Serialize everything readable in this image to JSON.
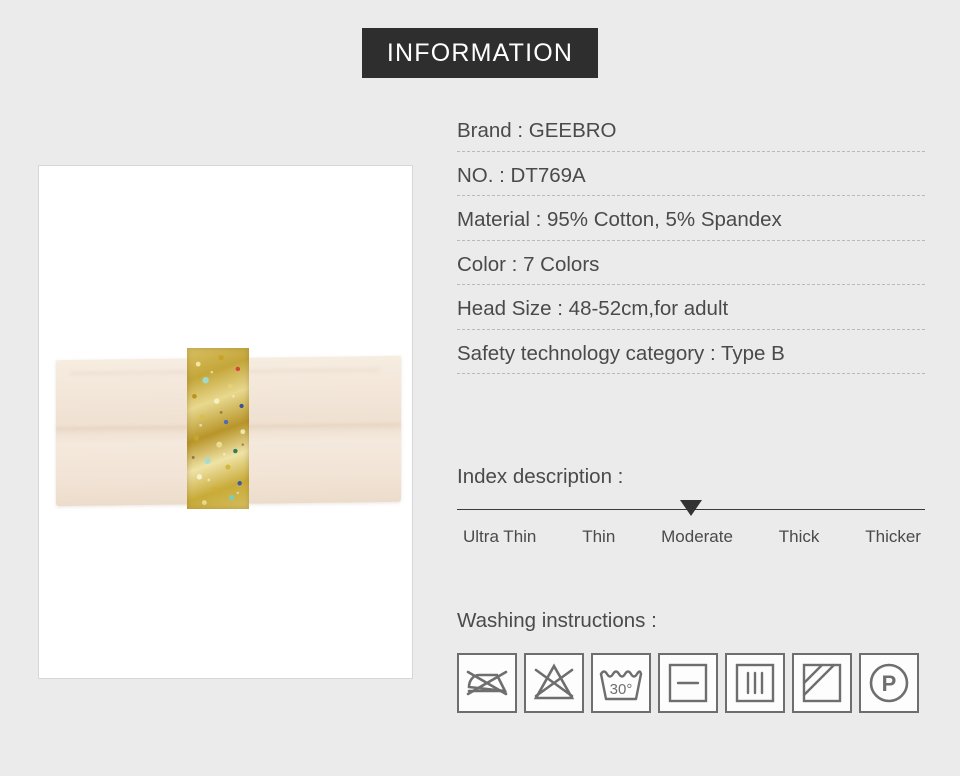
{
  "header": {
    "title": "INFORMATION",
    "background_color": "#2e2e2e",
    "text_color": "#ffffff"
  },
  "page": {
    "background_color": "#ebebeb",
    "text_color": "#4a4a4a"
  },
  "product_image": {
    "alt": "Cream knotted headband with gold sequin and bead embellishment panel",
    "band_color": "#f2e4d6",
    "bead_color": "#c9a227"
  },
  "specs": [
    {
      "label": "Brand",
      "value": "GEEBRO",
      "text": "Brand : GEEBRO"
    },
    {
      "label": "NO.",
      "value": "DT769A",
      "text": "NO. : DT769A"
    },
    {
      "label": "Material",
      "value": "95% Cotton, 5% Spandex",
      "text": "Material : 95% Cotton, 5% Spandex"
    },
    {
      "label": "Color",
      "value": "7 Colors",
      "text": "Color : 7 Colors"
    },
    {
      "label": "Head Size",
      "value": "48-52cm,for adult",
      "text": "Head Size : 48-52cm,for adult"
    },
    {
      "label": "Safety technology category",
      "value": "Type B",
      "text": "Safety technology category : Type B"
    }
  ],
  "index": {
    "label": "Index description :",
    "ticks": [
      "Ultra Thin",
      "Thin",
      "Moderate",
      "Thick",
      "Thicker"
    ],
    "selected": "Moderate",
    "selected_position_percent": 50,
    "marker_color": "#333333"
  },
  "washing": {
    "label": "Washing instructions :",
    "icons": [
      {
        "name": "do-not-iron-icon",
        "title": "Do not iron"
      },
      {
        "name": "do-not-bleach-icon",
        "title": "Do not bleach"
      },
      {
        "name": "wash-30-degrees-icon",
        "title": "Machine wash at 30°",
        "temperature": "30°"
      },
      {
        "name": "dry-flat-icon",
        "title": "Dry flat"
      },
      {
        "name": "drip-dry-icon",
        "title": "Drip dry"
      },
      {
        "name": "dry-in-shade-icon",
        "title": "Dry in shade"
      },
      {
        "name": "professional-dry-clean-icon",
        "title": "Professional dry clean (P)",
        "letter": "P"
      }
    ]
  }
}
